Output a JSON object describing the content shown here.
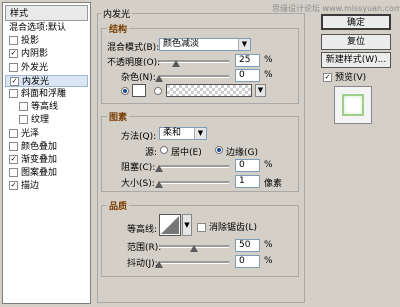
{
  "watermark": "思缘设计论坛 www.missyuan.com",
  "styles_list": {
    "header": "样式",
    "items": [
      {
        "label": "混合选项:默认",
        "checkbox": false,
        "checked": false,
        "selected": false,
        "indent": false
      },
      {
        "label": "投影",
        "checkbox": true,
        "checked": false,
        "selected": false,
        "indent": false
      },
      {
        "label": "内阴影",
        "checkbox": true,
        "checked": true,
        "selected": false,
        "indent": false
      },
      {
        "label": "外发光",
        "checkbox": true,
        "checked": false,
        "selected": false,
        "indent": false
      },
      {
        "label": "内发光",
        "checkbox": true,
        "checked": true,
        "selected": true,
        "indent": false
      },
      {
        "label": "斜面和浮雕",
        "checkbox": true,
        "checked": false,
        "selected": false,
        "indent": false
      },
      {
        "label": "等高线",
        "checkbox": true,
        "checked": false,
        "selected": false,
        "indent": true
      },
      {
        "label": "纹理",
        "checkbox": true,
        "checked": false,
        "selected": false,
        "indent": true
      },
      {
        "label": "光泽",
        "checkbox": true,
        "checked": false,
        "selected": false,
        "indent": false
      },
      {
        "label": "颜色叠加",
        "checkbox": true,
        "checked": false,
        "selected": false,
        "indent": false
      },
      {
        "label": "渐变叠加",
        "checkbox": true,
        "checked": true,
        "selected": false,
        "indent": false
      },
      {
        "label": "图案叠加",
        "checkbox": true,
        "checked": false,
        "selected": false,
        "indent": false
      },
      {
        "label": "描边",
        "checkbox": true,
        "checked": true,
        "selected": false,
        "indent": false
      }
    ]
  },
  "panel": {
    "title": "内发光",
    "structure": {
      "title": "结构",
      "blend_mode_label": "混合模式(B):",
      "blend_mode_value": "颜色减淡",
      "opacity_label": "不透明度(O):",
      "opacity_value": "25",
      "noise_label": "杂色(N):",
      "noise_value": "0",
      "percent": "%"
    },
    "elements": {
      "title": "图素",
      "technique_label": "方法(Q):",
      "technique_value": "柔和",
      "source_label": "源:",
      "center_label": "居中(E)",
      "edge_label": "边缘(G)",
      "choke_label": "阻塞(C):",
      "choke_value": "0",
      "size_label": "大小(S):",
      "size_value": "1",
      "size_unit": "像素",
      "percent": "%"
    },
    "quality": {
      "title": "品质",
      "contour_label": "等高线:",
      "antialias_label": "消除锯齿(L)",
      "range_label": "范围(R):",
      "range_value": "50",
      "jitter_label": "抖动(J):",
      "jitter_value": "0",
      "percent": "%"
    }
  },
  "buttons": {
    "ok": "确定",
    "reset": "复位",
    "new_style": "新建样式(W)...",
    "preview_label": "预览(V)"
  }
}
